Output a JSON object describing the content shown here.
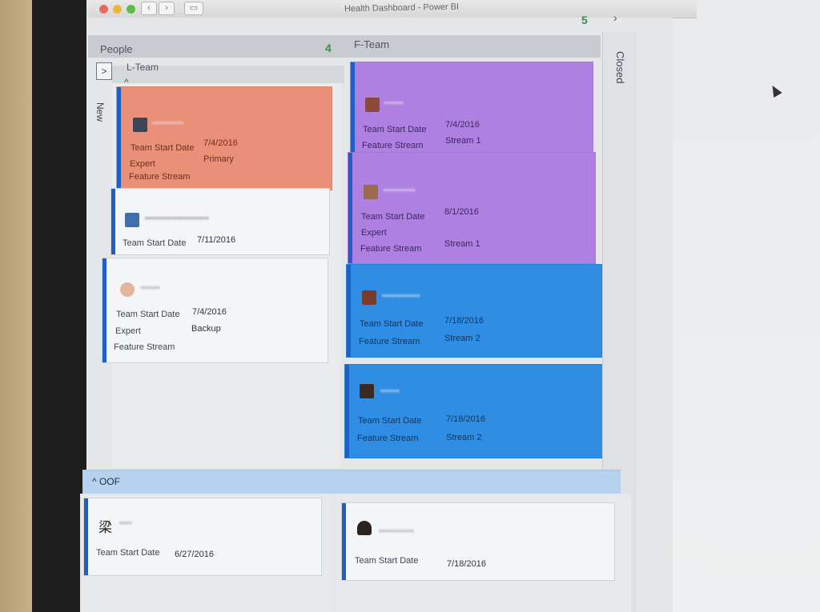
{
  "window": {
    "title": "Health Dashboard - Power BI"
  },
  "columns": {
    "people": {
      "label": "People",
      "count": "4"
    },
    "fteam": {
      "label": "F-Team",
      "count": "5"
    },
    "closed": {
      "label": "Closed",
      "expand_glyph": "›"
    }
  },
  "swimlanes": {
    "lteam": {
      "label": "L-Team",
      "collapse_glyph": "^"
    },
    "oof": {
      "label": "^ OOF"
    },
    "new": {
      "label": "New"
    },
    "expand_glyph": ">"
  },
  "cards": {
    "c1": {
      "team_start_label": "Team Start Date",
      "team_start": "7/4/2016",
      "expert_label": "Expert",
      "expert": "Primary",
      "stream_label": "Feature Stream",
      "name": "••••••••••"
    },
    "c2": {
      "team_start_label": "Team Start Date",
      "team_start": "7/11/2016",
      "name": "••••••••••••••••••••"
    },
    "c3": {
      "team_start_label": "Team Start Date",
      "team_start": "7/4/2016",
      "expert_label": "Expert",
      "expert": "Backup",
      "stream_label": "Feature Stream",
      "name": "••••••"
    },
    "c4": {
      "team_start_label": "Team Start Date",
      "team_start": "7/4/2016",
      "stream_label": "Feature Stream",
      "stream": "Stream 1",
      "name": "••••••"
    },
    "c5": {
      "team_start_label": "Team Start Date",
      "team_start": "8/1/2016",
      "expert_label": "Expert",
      "stream_label": "Feature Stream",
      "stream": "Stream 1",
      "name": "••••••••••"
    },
    "c6": {
      "team_start_label": "Team Start Date",
      "team_start": "7/18/2016",
      "stream_label": "Feature Stream",
      "stream": "Stream 2",
      "name": "••••••••••••"
    },
    "c7": {
      "team_start_label": "Team Start Date",
      "team_start": "7/18/2016",
      "stream_label": "Feature Stream",
      "stream": "Stream 2",
      "name": "••••••"
    },
    "c8": {
      "team_start_label": "Team Start Date",
      "team_start": "6/27/2016",
      "name": "••••"
    },
    "c9": {
      "team_start_label": "Team Start Date",
      "team_start": "7/18/2016",
      "name": "•••••••••••"
    }
  },
  "colors": {
    "orange": "#ea8f78",
    "purple": "#ae80e2",
    "blue": "#2f8de4",
    "stripe": "#1f5fc6",
    "count": "#3a8d49"
  }
}
